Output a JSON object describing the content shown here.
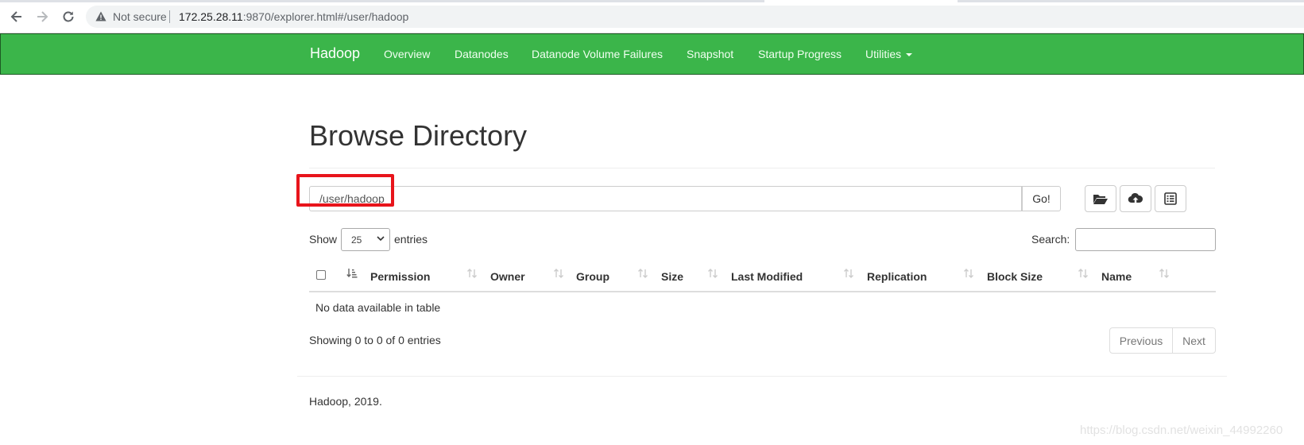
{
  "browser": {
    "security_label": "Not secure",
    "url_host": "172.25.28.11",
    "url_rest": ":9870/explorer.html#/user/hadoop"
  },
  "navbar": {
    "brand": "Hadoop",
    "links": [
      "Overview",
      "Datanodes",
      "Datanode Volume Failures",
      "Snapshot",
      "Startup Progress",
      "Utilities"
    ],
    "bg_color": "#3bb54a"
  },
  "page": {
    "title": "Browse Directory",
    "path_value": "/user/hadoop",
    "go_label": "Go!",
    "tool_icons": [
      "folder-open-icon",
      "cloud-upload-icon",
      "list-alt-icon"
    ],
    "highlight_color": "#e8141b"
  },
  "table_controls": {
    "show_label": "Show",
    "page_length": "25",
    "entries_label": "entries",
    "search_label": "Search:"
  },
  "table": {
    "columns": [
      "Permission",
      "Owner",
      "Group",
      "Size",
      "Last Modified",
      "Replication",
      "Block Size",
      "Name"
    ],
    "empty_message": "No data available in table",
    "info": "Showing 0 to 0 of 0 entries",
    "prev_label": "Previous",
    "next_label": "Next"
  },
  "footer": {
    "text": "Hadoop, 2019."
  },
  "watermark": "https://blog.csdn.net/weixin_44992260"
}
